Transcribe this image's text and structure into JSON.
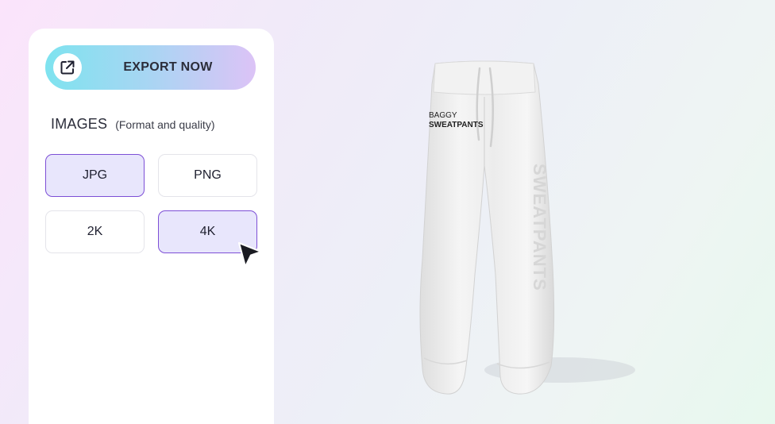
{
  "export": {
    "label": "EXPORT NOW",
    "icon": "external-link-icon"
  },
  "images_section": {
    "title": "IMAGES",
    "subtitle": "(Format and quality)"
  },
  "formats": [
    {
      "label": "JPG",
      "selected": true
    },
    {
      "label": "PNG",
      "selected": false
    }
  ],
  "qualities": [
    {
      "label": "2K",
      "selected": false
    },
    {
      "label": "4K",
      "selected": true
    }
  ],
  "product": {
    "print_line1": "BAGGY",
    "print_line2": "SWEATPANTS",
    "side_print": "SWEATPANTS"
  },
  "colors": {
    "selected_border": "#7d4fd6",
    "selected_fill": "#e8e6fc"
  }
}
